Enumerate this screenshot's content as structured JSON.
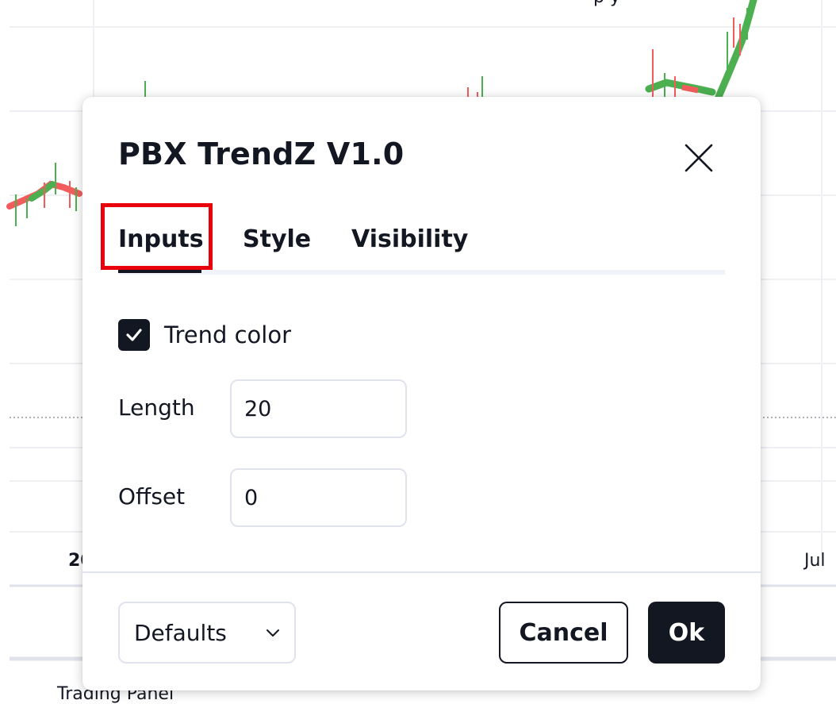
{
  "background": {
    "x_axis_left_label": "20",
    "x_axis_right_label": "Jul",
    "bottom_panel_label": "Trading Panel",
    "top_partial_text": "p y",
    "colors": {
      "up_candle": "#4caf50",
      "down_candle": "#f25c5c",
      "grid": "#eef0f4"
    }
  },
  "dialog": {
    "title": "PBX TrendZ V1.0",
    "close_icon": "close-icon",
    "tabs": [
      {
        "label": "Inputs",
        "active": true
      },
      {
        "label": "Style",
        "active": false
      },
      {
        "label": "Visibility",
        "active": false
      }
    ],
    "highlight_color": "#e8000b",
    "inputs": {
      "trend_color": {
        "label": "Trend color",
        "checked": true
      },
      "length": {
        "label": "Length",
        "value": "20"
      },
      "offset": {
        "label": "Offset",
        "value": "0"
      }
    },
    "footer": {
      "defaults_label": "Defaults",
      "cancel_label": "Cancel",
      "ok_label": "Ok"
    }
  }
}
